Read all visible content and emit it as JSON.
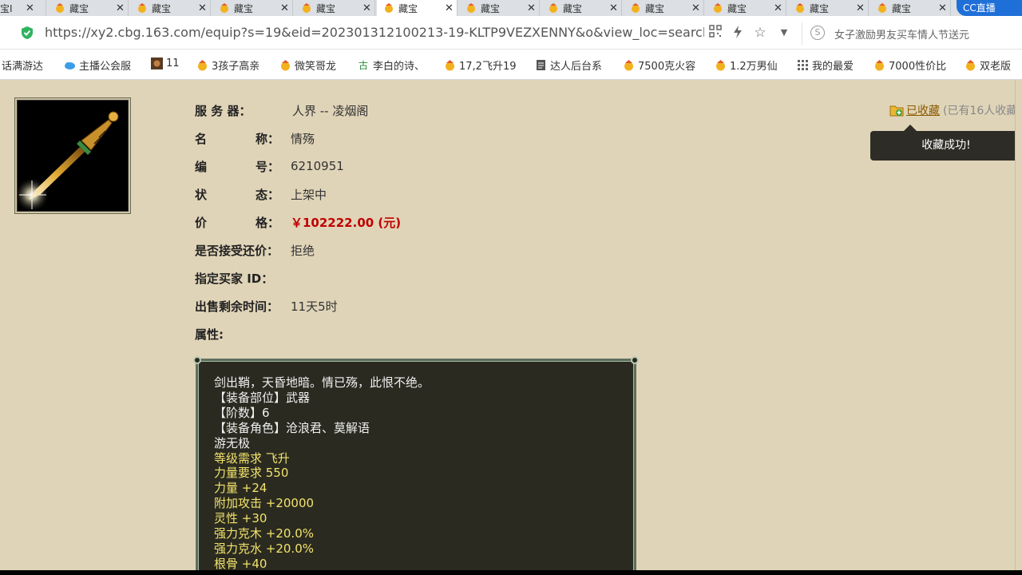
{
  "browser": {
    "tabs": [
      {
        "label": "宝I",
        "active": false
      },
      {
        "label": "藏宝",
        "active": false
      },
      {
        "label": "藏宝",
        "active": false
      },
      {
        "label": "藏宝",
        "active": false
      },
      {
        "label": "藏宝",
        "active": false
      },
      {
        "label": "藏宝",
        "active": true
      },
      {
        "label": "藏宝",
        "active": false
      },
      {
        "label": "藏宝",
        "active": false
      },
      {
        "label": "藏宝",
        "active": false
      },
      {
        "label": "藏宝",
        "active": false
      },
      {
        "label": "藏宝",
        "active": false
      },
      {
        "label": "藏宝",
        "active": false
      }
    ],
    "tab_close_glyph": "✕",
    "cc_badge": "CC直播",
    "url": "https://xy2.cbg.163.com/equip?s=19&eid=202301312100213-19-KLTP9VEZXENNY&o&view_loc=search_c",
    "search_placeholder": "女子激励男友买车情人节送元",
    "search_logo": "S",
    "bookmarks": [
      {
        "label": "话满游达",
        "icon": "none"
      },
      {
        "label": "主播公会服",
        "icon": "cloud-icon"
      },
      {
        "label": "11",
        "icon": "game-icon"
      },
      {
        "label": "3孩子高亲",
        "icon": "cbg-icon"
      },
      {
        "label": "微笑哥龙",
        "icon": "cbg-icon"
      },
      {
        "label": "李白的诗、",
        "icon": "poem-icon"
      },
      {
        "label": "17,2飞升19",
        "icon": "cbg-icon"
      },
      {
        "label": "达人后台系",
        "icon": "doc-icon"
      },
      {
        "label": "7500克火容",
        "icon": "cbg-icon"
      },
      {
        "label": "1.2万男仙",
        "icon": "cbg-icon"
      },
      {
        "label": "我的最爱",
        "icon": "grid-icon"
      },
      {
        "label": "7000性价比",
        "icon": "cbg-icon"
      },
      {
        "label": "双老版",
        "icon": "cbg-icon"
      }
    ]
  },
  "item": {
    "server_label": "服 务 器：",
    "server": "人界 -- 凌烟阁",
    "name_label": [
      "名",
      "称："
    ],
    "name": "情殇",
    "number_label": [
      "编",
      "号："
    ],
    "number": "6210951",
    "status_label": [
      "状",
      "态："
    ],
    "status": "上架中",
    "price_label": [
      "价",
      "格："
    ],
    "price": "￥102222.00 (元)",
    "bargain_label": "是否接受还价：",
    "bargain": "拒绝",
    "buyer_label": "指定买家 ID：",
    "remaining_label": "出售剩余时间：",
    "remaining": "11天5时",
    "attr_label": "属性:"
  },
  "favorite": {
    "label": "已收藏",
    "count_text": "(已有16人收藏",
    "toast": "收藏成功!"
  },
  "attributes": [
    {
      "text": "剑出鞘，天昏地暗。情已殇，此恨不绝。",
      "color": "white"
    },
    {
      "text": "【装备部位】武器",
      "color": "white"
    },
    {
      "text": "【阶数】6",
      "color": "white"
    },
    {
      "text": "【装备角色】沧浪君、莫解语",
      "color": "white"
    },
    {
      "text": "游无极",
      "color": "white"
    },
    {
      "text": "等级需求 飞升",
      "color": "yellow"
    },
    {
      "text": "力量要求 550",
      "color": "yellow"
    },
    {
      "text": "力量 +24",
      "color": "yellow"
    },
    {
      "text": "附加攻击 +20000",
      "color": "yellow"
    },
    {
      "text": "灵性 +30",
      "color": "yellow"
    },
    {
      "text": "强力克木 +20.0%",
      "color": "yellow"
    },
    {
      "text": "强力克水 +20.0%",
      "color": "yellow"
    },
    {
      "text": "根骨 +40",
      "color": "yellow"
    }
  ],
  "colors": {
    "page_bg": "#e0d4b8",
    "price": "#c00000",
    "attr_white": "#f0f0f0",
    "attr_yellow": "#f2e36b",
    "attr_bg": "#2a2a20"
  }
}
